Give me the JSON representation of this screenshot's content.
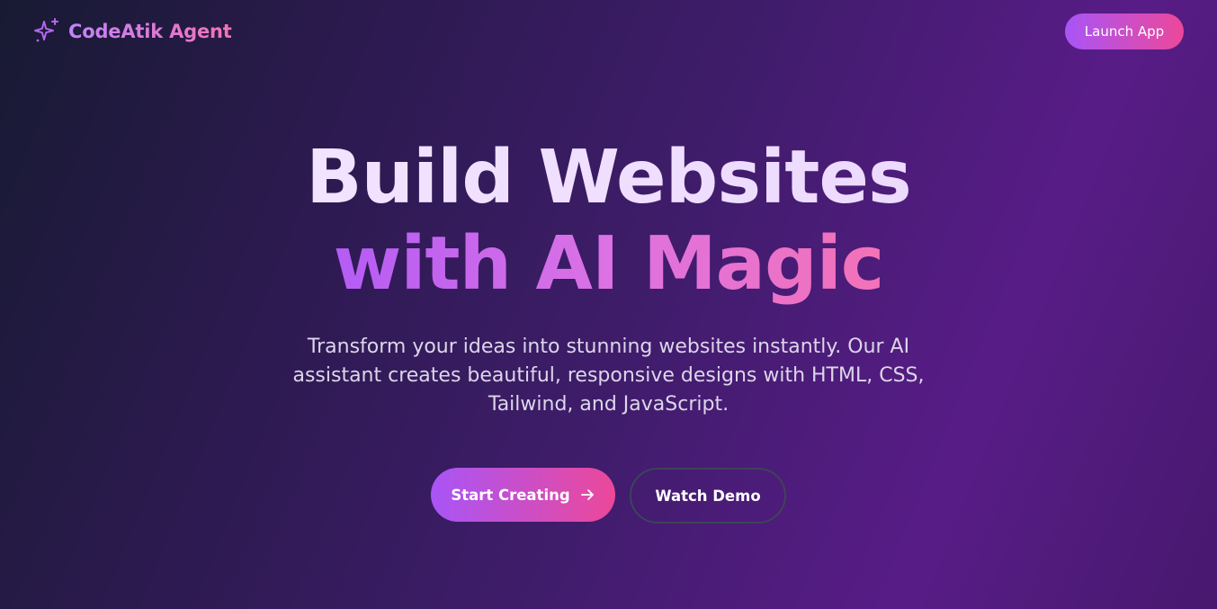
{
  "header": {
    "brand_icon": "sparkles-icon",
    "brand_name": "CodeAtik Agent",
    "launch_label": "Launch App"
  },
  "hero": {
    "headline_line1": "Build Websites",
    "headline_line2": "with AI Magic",
    "subtitle": "Transform your ideas into stunning websites instantly. Our AI assistant creates beautiful, responsive designs with HTML, CSS, Tailwind, and JavaScript."
  },
  "cta": {
    "start_label": "Start Creating",
    "start_icon": "arrow-right-icon",
    "demo_label": "Watch Demo"
  },
  "colors": {
    "accent_purple": "#a855f7",
    "accent_pink": "#ec4899",
    "background_dark": "#181a33",
    "background_purple": "#581c87"
  }
}
